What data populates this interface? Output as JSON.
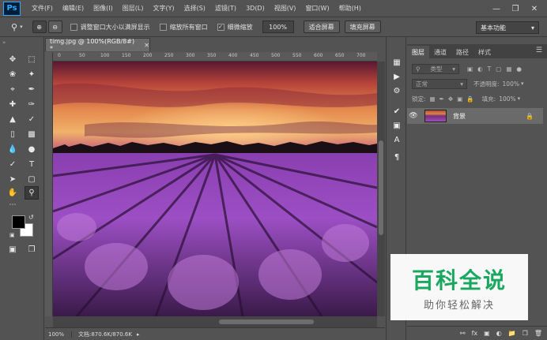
{
  "menu": {
    "app_logo": "Ps",
    "items": [
      "文件(F)",
      "编辑(E)",
      "图像(I)",
      "图层(L)",
      "文字(Y)",
      "选择(S)",
      "滤镜(T)",
      "3D(D)",
      "视图(V)",
      "窗口(W)",
      "帮助(H)"
    ]
  },
  "options": {
    "resize_windows_label": "调整窗口大小以满屏显示",
    "zoom_all_label": "缩放所有窗口",
    "scrubby_zoom_label": "细微缩放",
    "zoom_value": "100%",
    "fit_screen_label": "适合屏幕",
    "fill_screen_label": "填充屏幕",
    "workspace": "基本功能",
    "scrubby_checked": true
  },
  "document": {
    "tab_title": "timg.jpg @ 100%(RGB/8#) *",
    "ruler_ticks": [
      "0",
      "50",
      "100",
      "150",
      "200",
      "250",
      "300",
      "350",
      "400",
      "450",
      "500",
      "550",
      "600",
      "650",
      "700"
    ],
    "zoom": "100%",
    "doc_size": "文档:870.6K/870.6K"
  },
  "layers_panel": {
    "tabs": [
      "图层",
      "通道",
      "路径",
      "样式"
    ],
    "kind_label": "类型",
    "blend_mode": "正常",
    "opacity_label": "不透明度:",
    "opacity_value": "100%",
    "lock_label": "锁定:",
    "fill_label": "填充:",
    "fill_value": "100%",
    "layer_name": "背景"
  },
  "watermark": {
    "title": "百科全说",
    "subtitle": "助你轻松解决"
  }
}
